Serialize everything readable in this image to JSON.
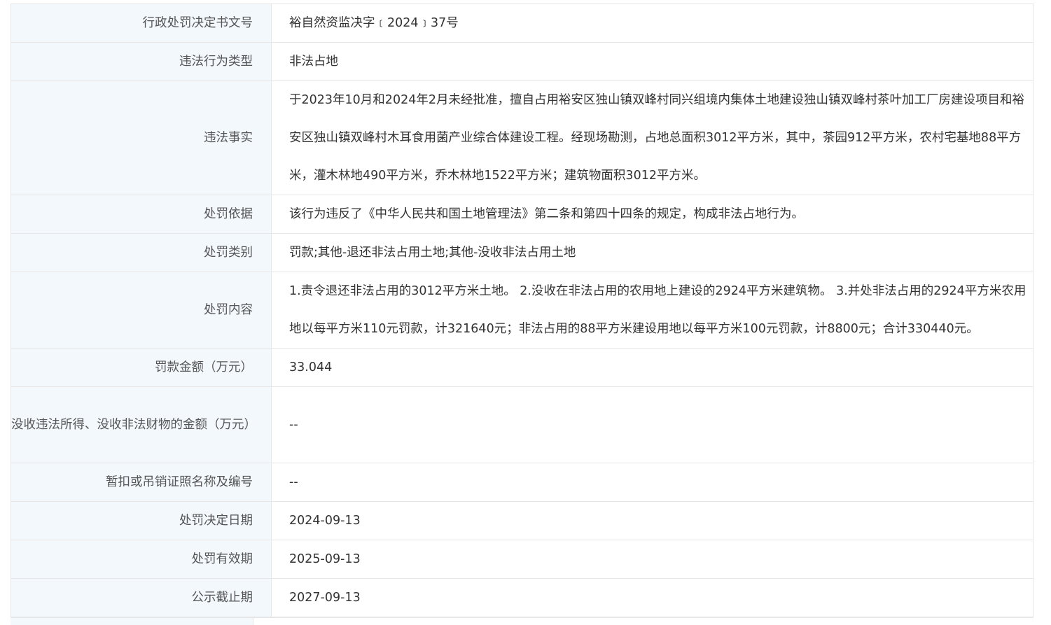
{
  "rows": [
    {
      "label": "行政处罚决定书文号",
      "value": "裕自然资监决字﹝2024﹞37号"
    },
    {
      "label": "违法行为类型",
      "value": "非法占地"
    },
    {
      "label": "违法事实",
      "value": "于2023年10月和2024年2月未经批准，擅自占用裕安区独山镇双峰村同兴组境内集体土地建设独山镇双峰村茶叶加工厂房建设项目和裕安区独山镇双峰村木耳食用菌产业综合体建设工程。经现场勘测，占地总面积3012平方米，其中，茶园912平方米，农村宅基地88平方米，灌木林地490平方米，乔木林地1522平方米；建筑物面积3012平方米。"
    },
    {
      "label": "处罚依据",
      "value": "该行为违反了《中华人民共和国土地管理法》第二条和第四十四条的规定，构成非法占地行为。"
    },
    {
      "label": "处罚类别",
      "value": "罚款;其他-退还非法占用土地;其他-没收非法占用土地"
    },
    {
      "label": "处罚内容",
      "value": "1.责令退还非法占用的3012平方米土地。 2.没收在非法占用的农用地上建设的2924平方米建筑物。 3.并处非法占用的2924平方米农用地以每平方米110元罚款，计321640元；非法占用的88平方米建设用地以每平方米100元罚款，计8800元；合计330440元。"
    },
    {
      "label": "罚款金额（万元）",
      "value": "33.044"
    },
    {
      "label": "没收违法所得、没收非法财物的金额（万元）",
      "value": "--"
    },
    {
      "label": "暂扣或吊销证照名称及编号",
      "value": "--"
    },
    {
      "label": "处罚决定日期",
      "value": "2024-09-13"
    },
    {
      "label": "处罚有效期",
      "value": "2025-09-13"
    },
    {
      "label": "公示截止期",
      "value": "2027-09-13"
    }
  ]
}
